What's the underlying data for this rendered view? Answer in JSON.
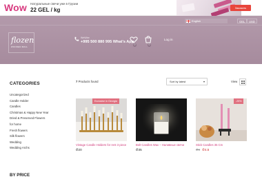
{
  "promo": {
    "title": "Wow",
    "tagline": "Натуральные свечи уже в Грузии",
    "price": "22 GEL / kg",
    "cta_label": "Заказать"
  },
  "topbar": {
    "language": "English",
    "currencies": [
      "GEL",
      "USD"
    ]
  },
  "header": {
    "logo_word": "flozen",
    "logo_sub": "WOODEN MALL",
    "phone_label": "WeWire",
    "phone_number": "+995 500 880 995 What's App",
    "wishlist_count": "0",
    "cart_count": "0",
    "login_label": "Log in"
  },
  "sidebar": {
    "title": "CATEGORIES",
    "categories": [
      "Uncategorized",
      "Candle Holder",
      "Candles",
      "Christmas & Happy New Year",
      "Dried & Preserved Flowers",
      "for home",
      "Fresh flowers",
      "Silk flowers",
      "Wedding",
      "Wedding Archs"
    ],
    "price_title": "BY PRICE"
  },
  "toolbar": {
    "found_count": "7",
    "found_label": "Products found",
    "sort_value": "Sort by latest",
    "view_label": "View"
  },
  "products": [
    {
      "badge": "Exclusive in Georgia",
      "name": "Vintage Candle Holders for rent 3 piece",
      "price": "20"
    },
    {
      "badge": "",
      "name": "Bolt Candles Wax – Наливные свечи",
      "price": "35"
    },
    {
      "badge": "-25%",
      "name": "Stick Candles 35 Cm",
      "old_price": "6",
      "price": "4.5"
    }
  ],
  "colors": {
    "accent": "#d03a7a",
    "header_bg": "#a68b9d",
    "badge": "#e0707f"
  }
}
